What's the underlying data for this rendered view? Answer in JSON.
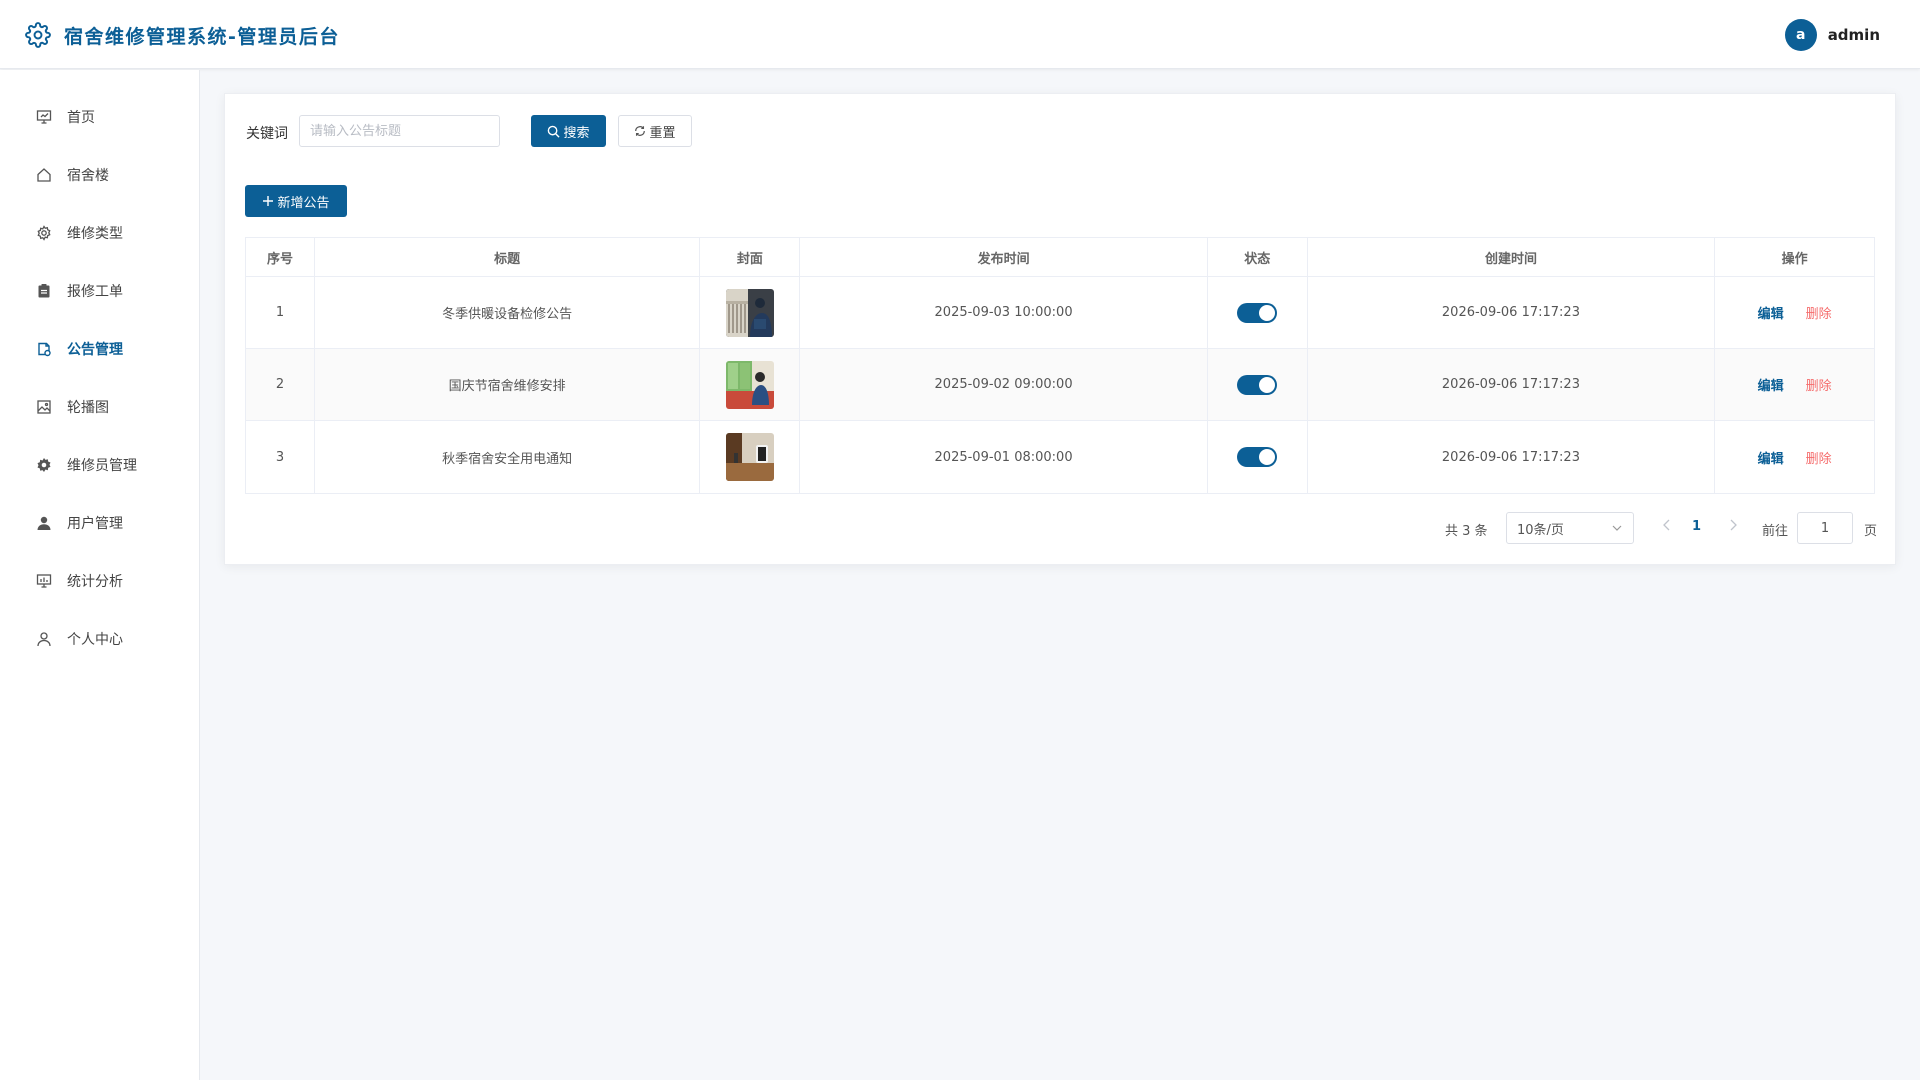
{
  "app": {
    "title": "宿舍维修管理系统-管理员后台",
    "logo_icon": "gear-icon",
    "brand_color": "#0c5f96"
  },
  "user": {
    "avatar_letter": "a",
    "name": "admin"
  },
  "sidebar": {
    "items": [
      {
        "label": "首页",
        "icon": "presentation-icon",
        "active": false
      },
      {
        "label": "宿舍楼",
        "icon": "home-icon",
        "active": false
      },
      {
        "label": "维修类型",
        "icon": "gear-icon",
        "active": false
      },
      {
        "label": "报修工单",
        "icon": "clipboard-icon",
        "active": false
      },
      {
        "label": "公告管理",
        "icon": "notice-icon",
        "active": true
      },
      {
        "label": "轮播图",
        "icon": "picture-icon",
        "active": false
      },
      {
        "label": "维修员管理",
        "icon": "cog-filled-icon",
        "active": false
      },
      {
        "label": "用户管理",
        "icon": "user-filled-icon",
        "active": false
      },
      {
        "label": "统计分析",
        "icon": "data-board-icon",
        "active": false
      },
      {
        "label": "个人中心",
        "icon": "user-icon",
        "active": false
      }
    ]
  },
  "search": {
    "label": "关键词",
    "placeholder": "请输入公告标题",
    "value": "",
    "search_label": "搜索",
    "reset_label": "重置"
  },
  "toolbar": {
    "add_label": "新增公告"
  },
  "table": {
    "columns": [
      "序号",
      "标题",
      "封面",
      "发布时间",
      "状态",
      "创建时间",
      "操作"
    ],
    "edit_label": "编辑",
    "delete_label": "删除",
    "rows": [
      {
        "index": "1",
        "title": "冬季供暖设备检修公告",
        "cover": "cover-image-1",
        "publish_time": "2025-09-03 10:00:00",
        "enabled": true,
        "created_time": "2026-09-06 17:17:23"
      },
      {
        "index": "2",
        "title": "国庆节宿舍维修安排",
        "cover": "cover-image-2",
        "publish_time": "2025-09-02 09:00:00",
        "enabled": true,
        "created_time": "2026-09-06 17:17:23"
      },
      {
        "index": "3",
        "title": "秋季宿舍安全用电通知",
        "cover": "cover-image-3",
        "publish_time": "2025-09-01 08:00:00",
        "enabled": true,
        "created_time": "2026-09-06 17:17:23"
      }
    ]
  },
  "pagination": {
    "total_text": "共 3 条",
    "page_size": "10条/页",
    "current_page": "1",
    "goto_label": "前往",
    "goto_value": "1",
    "page_suffix": "页"
  }
}
